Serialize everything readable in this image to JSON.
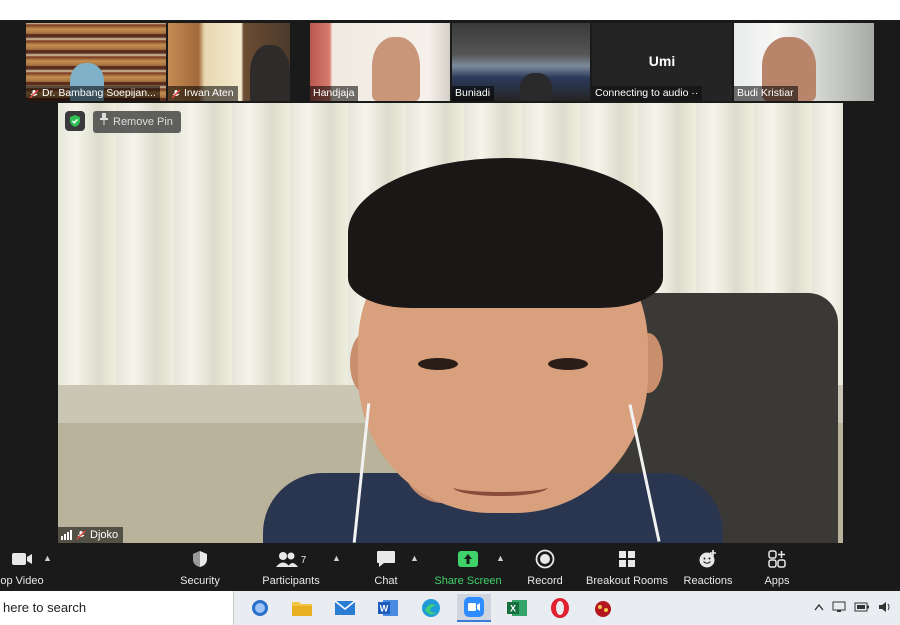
{
  "gallery": {
    "tiles": [
      {
        "name": "Dr. Bambang Soepijan...",
        "muted": true
      },
      {
        "name": "Irwan Aten",
        "muted": true
      },
      {
        "name": "Handjaja",
        "muted": false
      },
      {
        "name": "Buniadi",
        "muted": false
      },
      {
        "name": "Connecting to audio",
        "muted": false,
        "center_label": "Umi",
        "status_suffix": "··"
      },
      {
        "name": "Budi Kristiar",
        "muted": false
      }
    ]
  },
  "main_video": {
    "remove_pin_label": "Remove Pin",
    "speaker_name": "Djoko"
  },
  "toolbar": {
    "stop_video": "op Video",
    "security": "Security",
    "participants": "Participants",
    "participant_count": "7",
    "chat": "Chat",
    "share_screen": "Share Screen",
    "record": "Record",
    "breakout_rooms": "Breakout Rooms",
    "reactions": "Reactions",
    "apps": "Apps"
  },
  "taskbar": {
    "search_text": "here to search",
    "apps": [
      "outlook-icon",
      "file-explorer-icon",
      "mail-icon",
      "word-icon",
      "edge-icon",
      "zoom-icon",
      "excel-icon",
      "opera-icon",
      "game-icon"
    ]
  },
  "colors": {
    "share_green": "#3fd26b",
    "zoom_blue": "#2d8cff",
    "toolbar_bg": "#1a1a1a"
  }
}
